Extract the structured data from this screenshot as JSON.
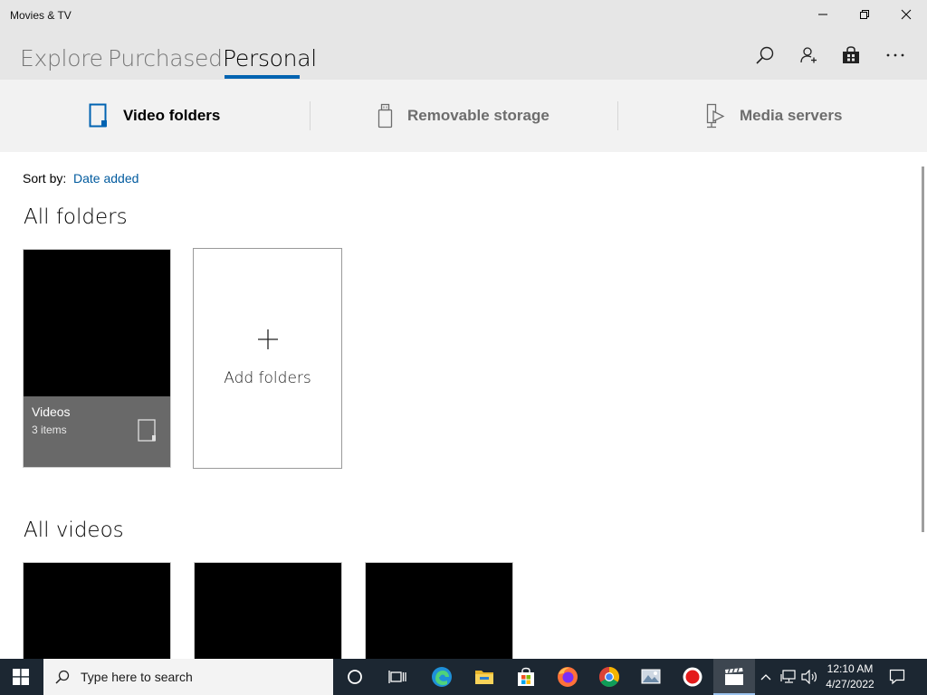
{
  "window": {
    "title": "Movies & TV"
  },
  "pivots": [
    {
      "label": "Explore",
      "active": false
    },
    {
      "label": "Purchased",
      "active": false
    },
    {
      "label": "Personal",
      "active": true
    }
  ],
  "header_icons": [
    "search-icon",
    "account-icon",
    "store-icon",
    "more-icon"
  ],
  "subtabs": [
    {
      "label": "Video folders",
      "icon": "tablet-icon",
      "active": true
    },
    {
      "label": "Removable storage",
      "icon": "usb-drive-icon",
      "active": false
    },
    {
      "label": "Media servers",
      "icon": "media-server-icon",
      "active": false
    }
  ],
  "sort": {
    "label": "Sort by:",
    "value": "Date added"
  },
  "sections": {
    "folders": "All folders",
    "videos": "All videos"
  },
  "folders": [
    {
      "name": "Videos",
      "count": "3 items"
    }
  ],
  "add_folder": {
    "label": "Add folders"
  },
  "videos_visible": 3,
  "taskbar": {
    "search_placeholder": "Type here to search",
    "apps": [
      "task-view-icon",
      "edge-icon",
      "file-explorer-icon",
      "store-icon",
      "firefox-icon",
      "chrome-icon",
      "photos-icon",
      "record-icon",
      "movies-tv-icon"
    ],
    "active_app": "movies-tv-icon",
    "time": "12:10 AM",
    "date": "4/27/2022"
  },
  "colors": {
    "accent": "#0063b1",
    "link": "#005a9e",
    "titlebar": "#e6e6e6",
    "taskbar": "#1c2732"
  }
}
